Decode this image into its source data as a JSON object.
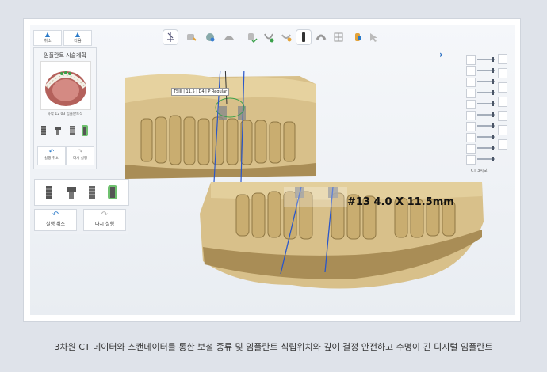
{
  "nav": {
    "undo_label": "취소",
    "redo_label": "다음"
  },
  "toolbar": {
    "icons": [
      "implant-tool-icon",
      "crown-icon",
      "sphere-icon",
      "dome-icon",
      "tooth-check-icon",
      "tooth-green-icon",
      "tooth-half-icon",
      "bar-tooth-icon",
      "arch-icon",
      "tooth-grid-icon",
      "hand-tool-icon",
      "cursor-tool-icon"
    ]
  },
  "left_panel": {
    "title": "임플란트 시술계획",
    "jaw_caption": "하악 12 03 임플란트식",
    "undo_label": "실행 취소",
    "redo_label": "다시 실행"
  },
  "zoom_panel": {
    "undo_label": "실행 취소",
    "redo_label": "다시 실행"
  },
  "right_panel": {
    "ct_label": "CT 3시보"
  },
  "scene": {
    "small_tag": "TSIII | 11.5 | D4 | P Regular",
    "big_tag": "#13 4.0 X 11.5mm"
  },
  "caption": "3차원 CT 데이터와 스캔데이터를 통한 보철 종류 및 임플란트 식립위치와 깊이 결정 안전하고 수명이 긴 디지털 임플란트",
  "colors": {
    "accent": "#2a7ac9",
    "model": "#d7bf86",
    "model_shadow": "#9c8552",
    "implant_axis": "#2a56c9"
  }
}
